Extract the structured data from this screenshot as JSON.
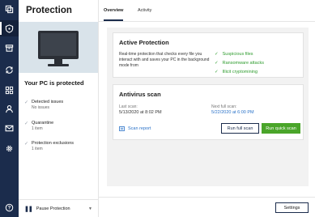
{
  "app": {
    "title": "Protection"
  },
  "nav": {
    "icons": [
      "copy-icon",
      "shield-icon",
      "archive-icon",
      "sync-icon",
      "grid-icon",
      "account-icon",
      "mail-icon",
      "settings-icon",
      "help-icon"
    ],
    "active": "shield-icon"
  },
  "sidebar": {
    "status": "Your PC is protected",
    "items": [
      {
        "label": "Detected issues",
        "sub": "No issues"
      },
      {
        "label": "Quarantine",
        "sub": "1 item"
      },
      {
        "label": "Protection exclusions",
        "sub": "1 item"
      }
    ],
    "pause_label": "Pause Protection"
  },
  "tabs": [
    {
      "label": "Overview",
      "active": true
    },
    {
      "label": "Activity",
      "active": false
    }
  ],
  "active_protection": {
    "title": "Active Protection",
    "description": "Real-time protection that checks every file you interact with and saves your PC in the background mode from",
    "features": [
      "Suspicious files",
      "Ransomware attacks",
      "Illicit cryptomining"
    ]
  },
  "antivirus_scan": {
    "title": "Antivirus scan",
    "last_scan_label": "Last scan:",
    "last_scan_value": "5/13/2020 at 8:02 PM",
    "next_scan_label": "Next full scan:",
    "next_scan_value": "5/22/2020 at 6:00 PM",
    "scan_report_label": "Scan report",
    "run_full_label": "Run full scan",
    "run_quick_label": "Run quick scan"
  },
  "footer": {
    "settings_label": "Settings"
  },
  "colors": {
    "rail": "#1b2c4c",
    "accent_green": "#4aa52a",
    "link_blue": "#2a72c8",
    "hero_bg": "#d9e3ea"
  }
}
